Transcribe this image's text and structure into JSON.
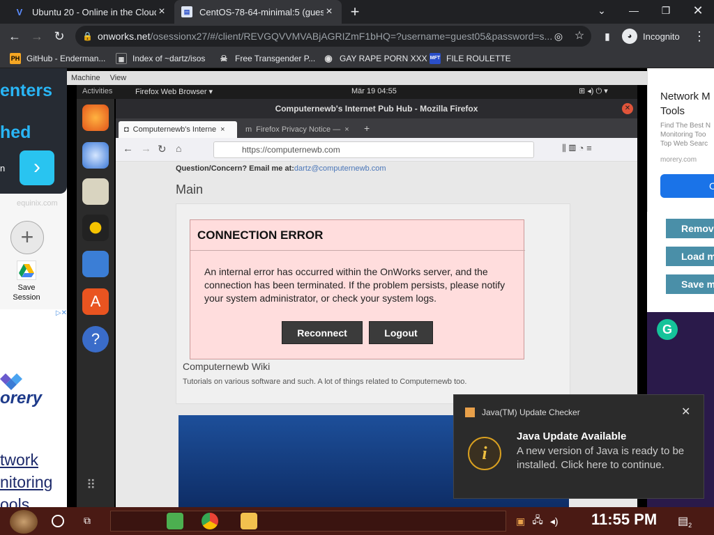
{
  "browser": {
    "tabs": [
      {
        "title": "Ubuntu 20 - Online in the Cloud",
        "icon": "v-logo-icon"
      },
      {
        "title": "CentOS-78-64-minimal:5 (guest0",
        "icon": "onworks-favicon-icon"
      }
    ],
    "address": {
      "host": "onworks.net",
      "rest": "/osessionx27/#/client/REVGQVVMVABjAGRIZmF1bHQ=?username=guest05&password=s..."
    },
    "incognito_label": "Incognito",
    "bookmarks": [
      {
        "label": "GitHub - Enderman...",
        "icon": "ph-icon",
        "color": "#f5a623"
      },
      {
        "label": "Index of ~dartz/isos",
        "icon": "folder-index-icon",
        "color": "#dddddd"
      },
      {
        "label": "Free Transgender P...",
        "icon": "skull-icon",
        "color": "#dddddd"
      },
      {
        "label": "GAY RAPE PORN XXX",
        "icon": "globe-icon",
        "color": "#dddddd"
      },
      {
        "label": "FILE ROULETTE",
        "icon": "mft-icon",
        "color": "#2a4fc9"
      }
    ]
  },
  "left_panel": {
    "ad_line1": "enters",
    "ad_line2": "hed",
    "ad_line3": "n",
    "ad_domain": "equinix.com",
    "save_session_label": "Save Session",
    "ad2_brand": "orery",
    "ad2_text_lines": [
      "twork",
      "nitoring",
      "ools"
    ]
  },
  "vm": {
    "menu": [
      "Machine",
      "View"
    ],
    "gnome": {
      "activities": "Activities",
      "app": "Firefox Web Browser ▾",
      "clock": "Mär 19  04:55"
    },
    "firefox": {
      "window_title": "Computernewb's Internet Pub Hub - Mozilla Firefox",
      "tabs": [
        "Computernewb's Interne",
        "Firefox Privacy Notice —"
      ],
      "url": "https://computernewb.com",
      "email_prefix": "Question/Concern? Email me at:",
      "email": "dartz@computernewb.com",
      "main_heading": "Main",
      "wiki_title": "Computernewb Wiki",
      "wiki_desc": "Tutorials on various software and such. A lot of things related to Computernewb too."
    }
  },
  "modal": {
    "title": "CONNECTION ERROR",
    "message": "An internal error has occurred within the OnWorks server, and the connection has been terminated. If the problem persists, please notify your system administrator, or check your system logs.",
    "reconnect": "Reconnect",
    "logout": "Logout"
  },
  "right_panel": {
    "ad_title_lines": [
      "Network M",
      "Tools"
    ],
    "ad_desc_lines": [
      "Find The Best N",
      "Monitoring Too",
      "Top Web Searc"
    ],
    "ad_domain": "morery.com",
    "ad_button": "O",
    "buttons": [
      "Remov",
      "Load m",
      "Save m"
    ]
  },
  "toast": {
    "app": "Java(TM) Update Checker",
    "title": "Java Update Available",
    "message": "A new version of Java is ready to be installed. Click here to continue."
  },
  "taskbar": {
    "clock": "11:55 PM",
    "notification_count": "2"
  }
}
